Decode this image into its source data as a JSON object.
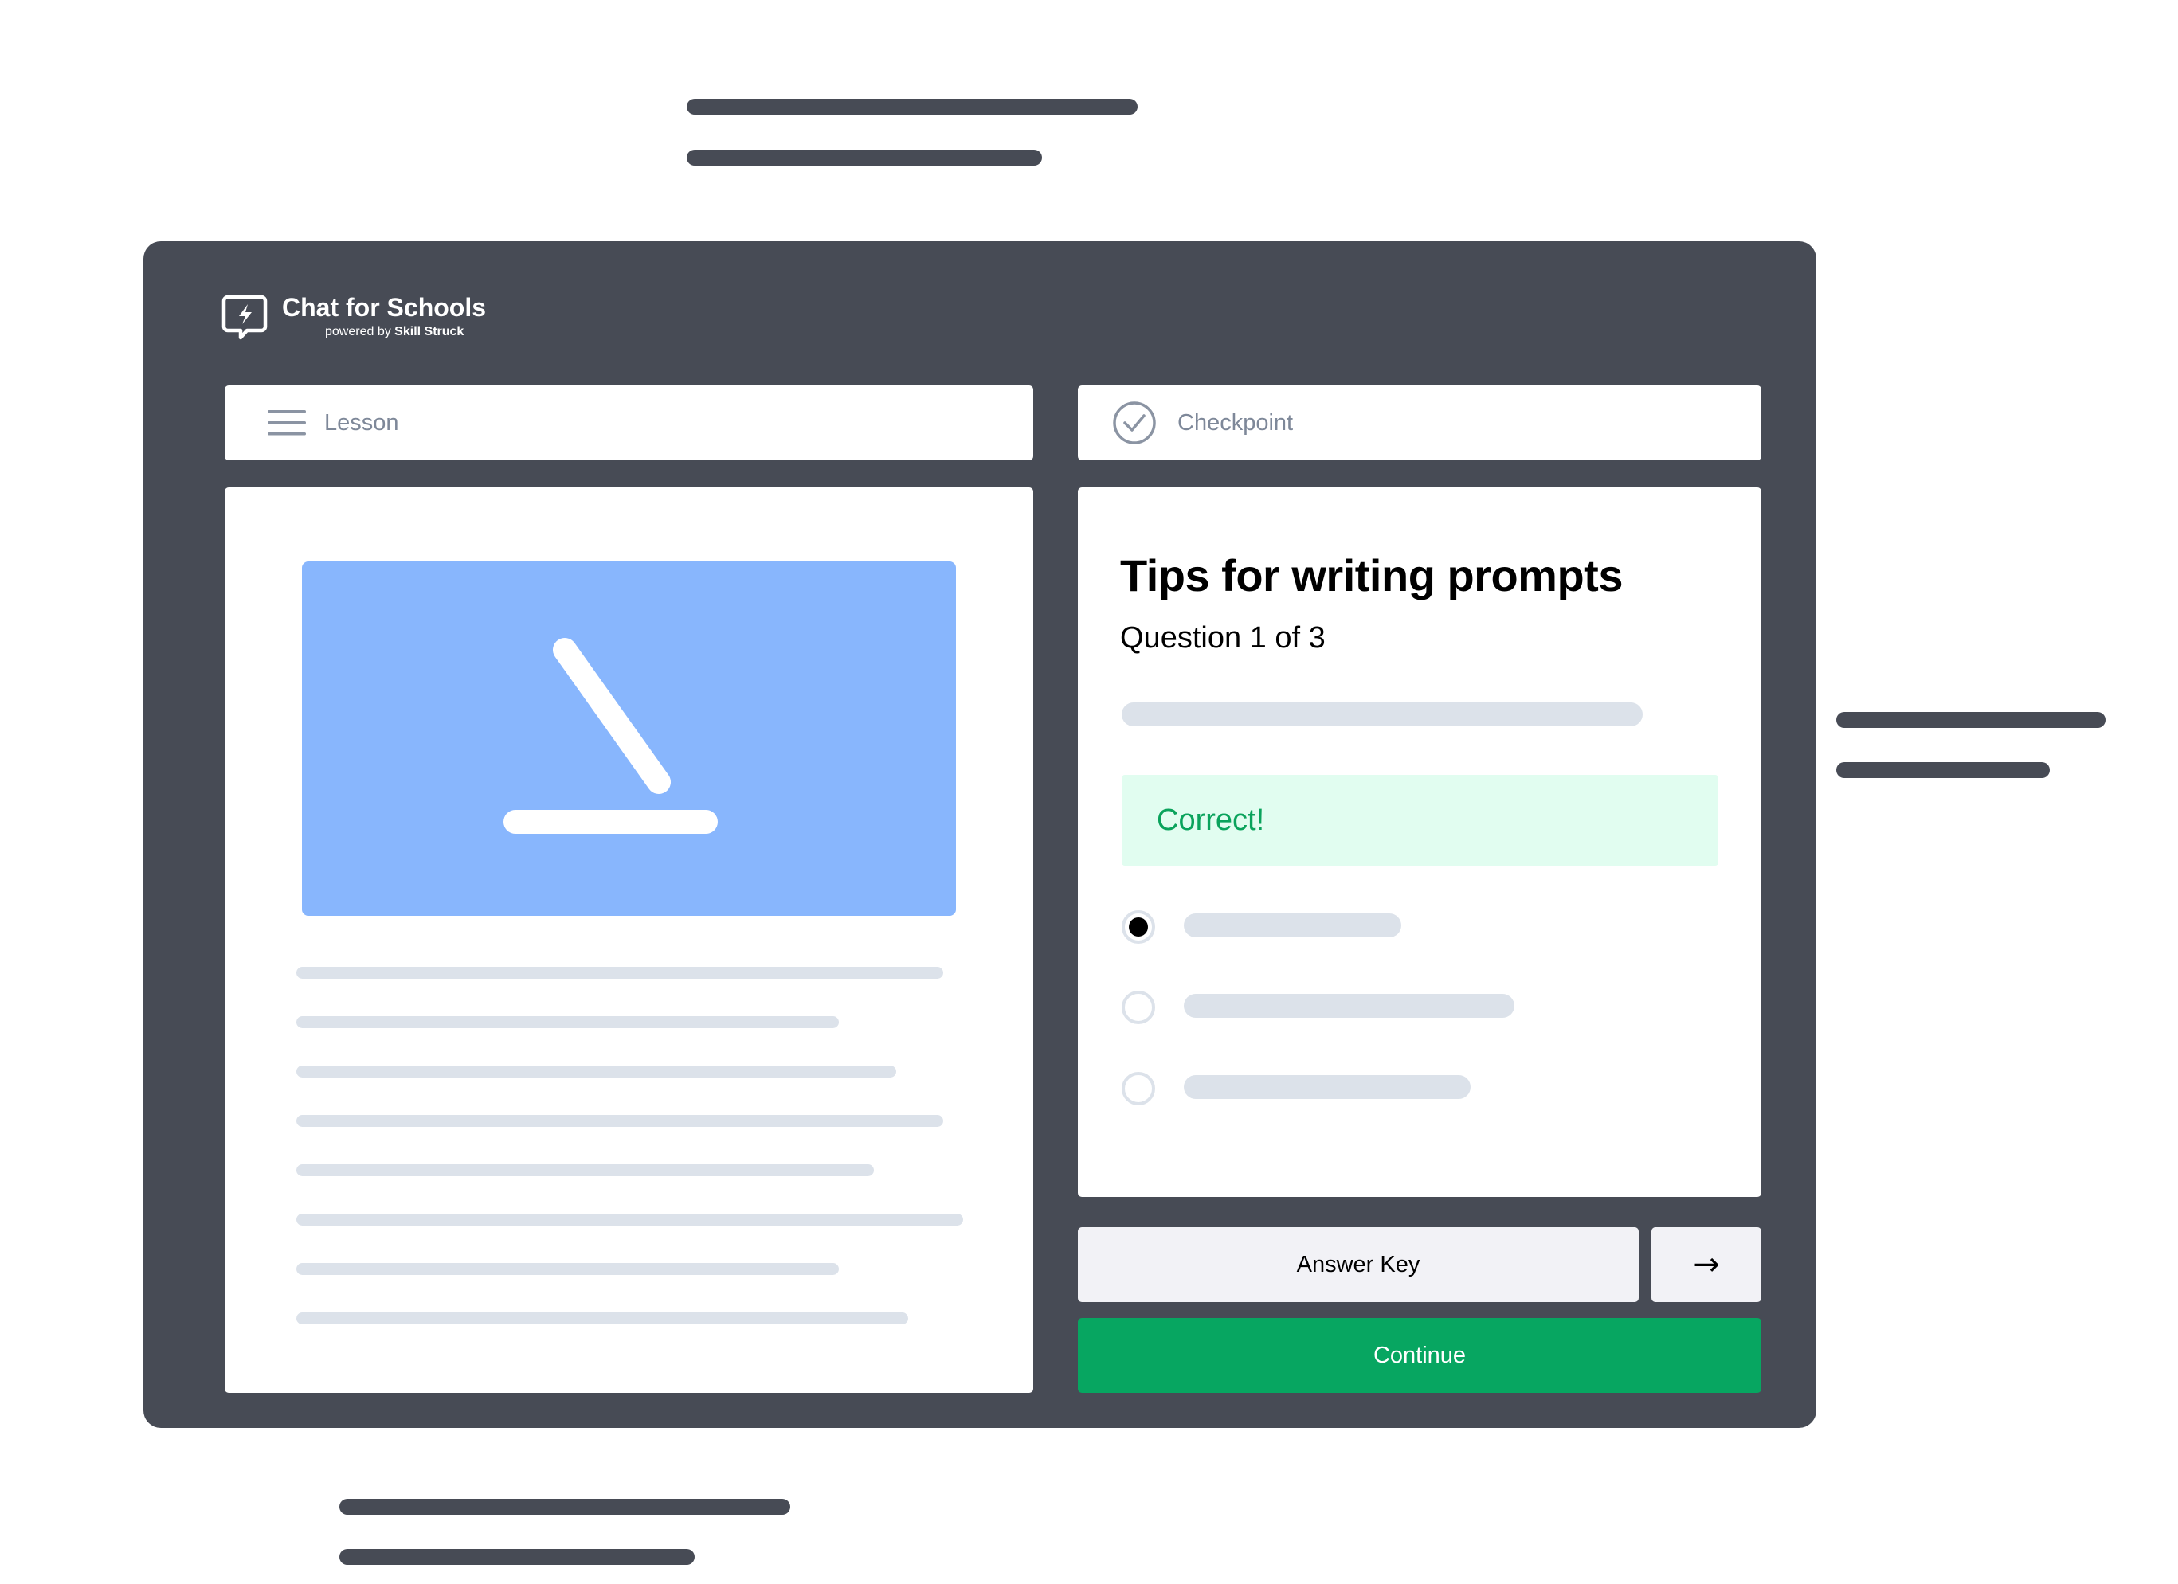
{
  "app": {
    "name": "Chat for Schools",
    "tagline_prefix": "powered by",
    "tagline_brand": "Skill Struck",
    "logo_icon": "lightning-chat-bubble-icon"
  },
  "tabs": {
    "lesson": {
      "label": "Lesson",
      "icon": "hamburger-menu-icon"
    },
    "checkpoint": {
      "label": "Checkpoint",
      "icon": "check-circle-icon"
    }
  },
  "checkpoint": {
    "title": "Tips for writing prompts",
    "progress_text": "Question 1 of 3",
    "feedback": "Correct!",
    "options": [
      {
        "selected": true
      },
      {
        "selected": false
      },
      {
        "selected": false
      }
    ]
  },
  "actions": {
    "answer_key_label": "Answer Key",
    "next_icon": "→",
    "continue_label": "Continue"
  },
  "colors": {
    "panel": "#474b55",
    "accent_green": "#07a661",
    "feedback_bg": "#e1fdf0",
    "feedback_text": "#0aa35c",
    "image_blue": "#88b6fd",
    "skeleton": "#dce2ea",
    "button_light": "#f2f2f6"
  }
}
